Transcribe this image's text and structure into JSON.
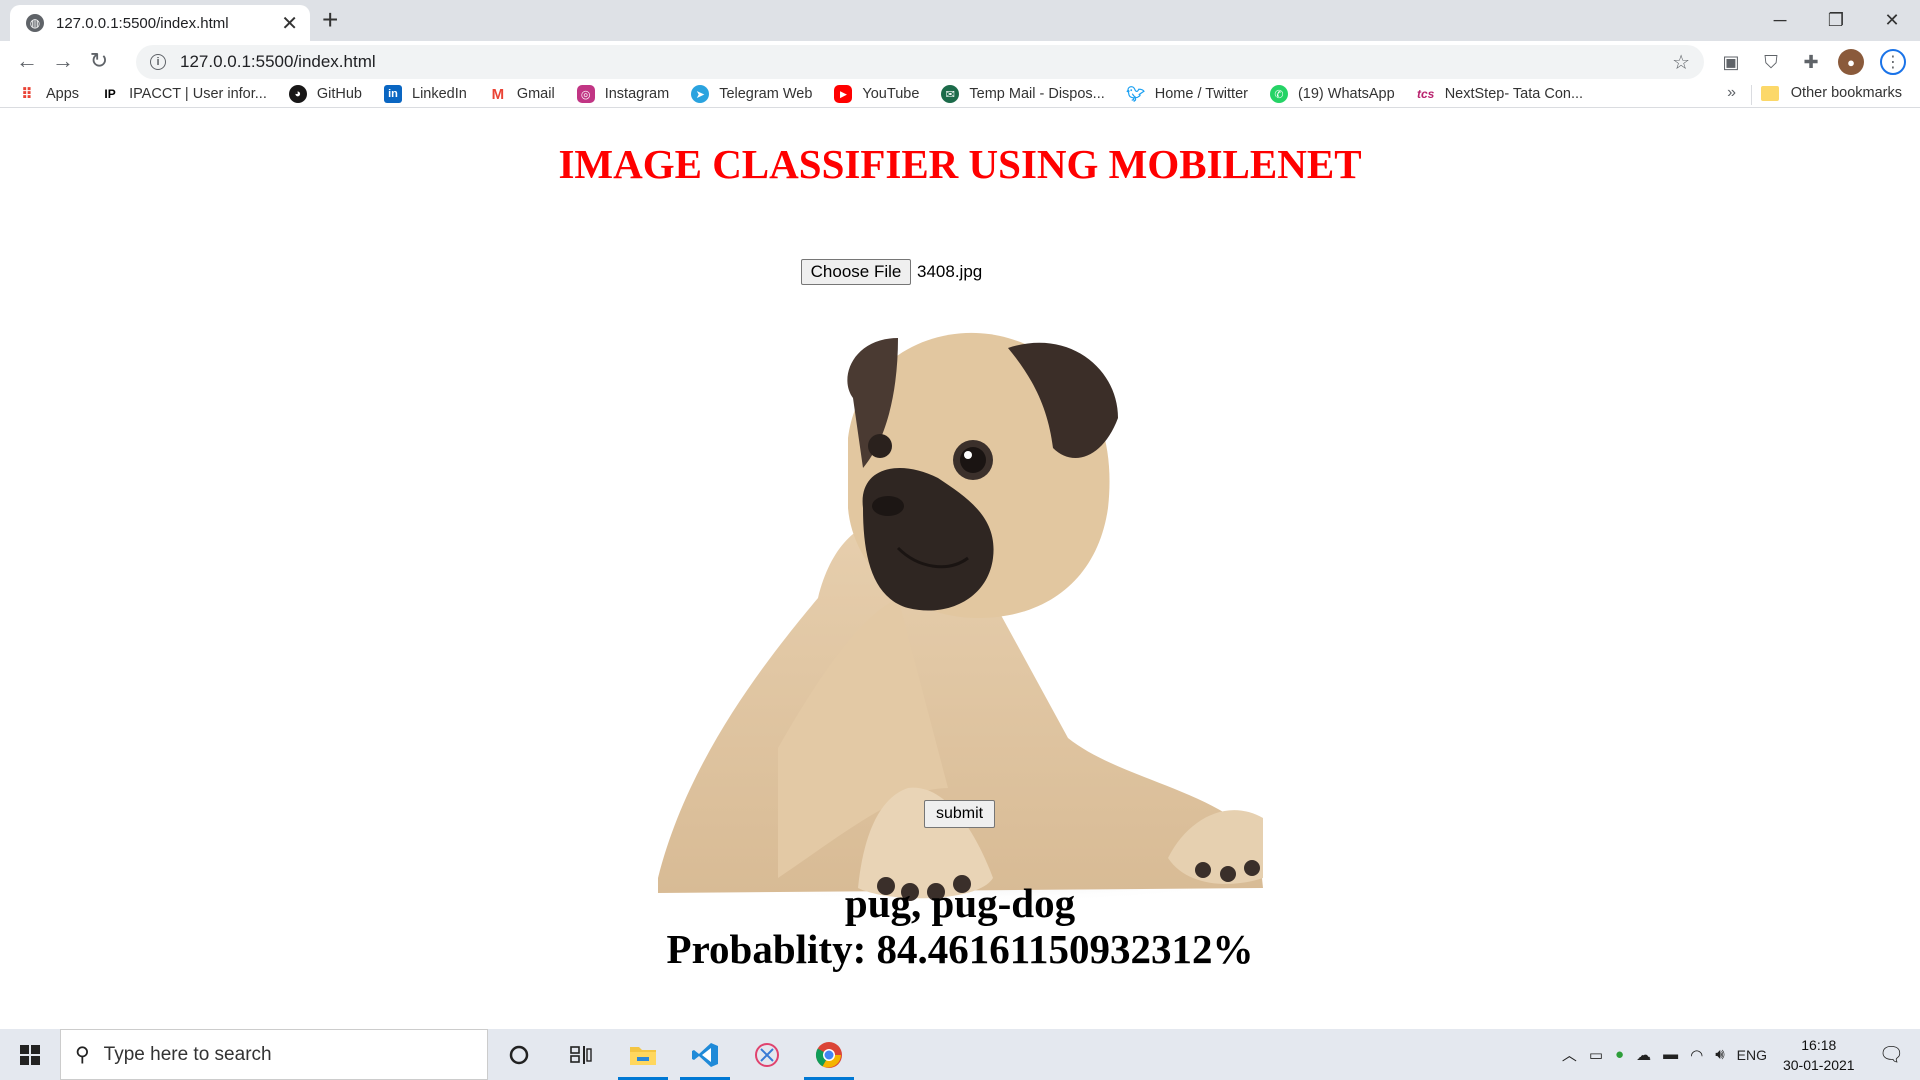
{
  "browser": {
    "tab_title": "127.0.0.1:5500/index.html",
    "url": "127.0.0.1:5500/index.html",
    "bookmarks": [
      {
        "label": "Apps",
        "icon": "apps-grid-icon",
        "color": "#ea4335"
      },
      {
        "label": "IPACCT | User infor...",
        "icon": "ipacct-icon",
        "color": "#000000"
      },
      {
        "label": "GitHub",
        "icon": "github-icon",
        "color": "#181717"
      },
      {
        "label": "LinkedIn",
        "icon": "linkedin-icon",
        "color": "#0a66c2"
      },
      {
        "label": "Gmail",
        "icon": "gmail-icon",
        "color": "#ea4335"
      },
      {
        "label": "Instagram",
        "icon": "instagram-icon",
        "color": "#c13584"
      },
      {
        "label": "Telegram Web",
        "icon": "telegram-icon",
        "color": "#2aa3df"
      },
      {
        "label": "YouTube",
        "icon": "youtube-icon",
        "color": "#ff0000"
      },
      {
        "label": "Temp Mail - Dispos...",
        "icon": "tempmail-icon",
        "color": "#1c6b4a"
      },
      {
        "label": "Home / Twitter",
        "icon": "twitter-icon",
        "color": "#1da1f2"
      },
      {
        "label": "(19) WhatsApp",
        "icon": "whatsapp-icon",
        "color": "#25d366"
      },
      {
        "label": "NextStep- Tata Con...",
        "icon": "tcs-icon",
        "color": "#b8226d"
      }
    ],
    "other_bookmarks": "Other bookmarks"
  },
  "page": {
    "title": "IMAGE CLASSIFIER USING MOBILENET",
    "choose_file_label": "Choose File",
    "file_name": "3408.jpg",
    "submit_label": "submit",
    "result_class": "pug, pug-dog",
    "result_probability": "Probablity: 84.46161150932312%",
    "title_color": "#ff0000"
  },
  "taskbar": {
    "search_placeholder": "Type here to search",
    "language": "ENG",
    "time": "16:18",
    "date": "30-01-2021"
  }
}
